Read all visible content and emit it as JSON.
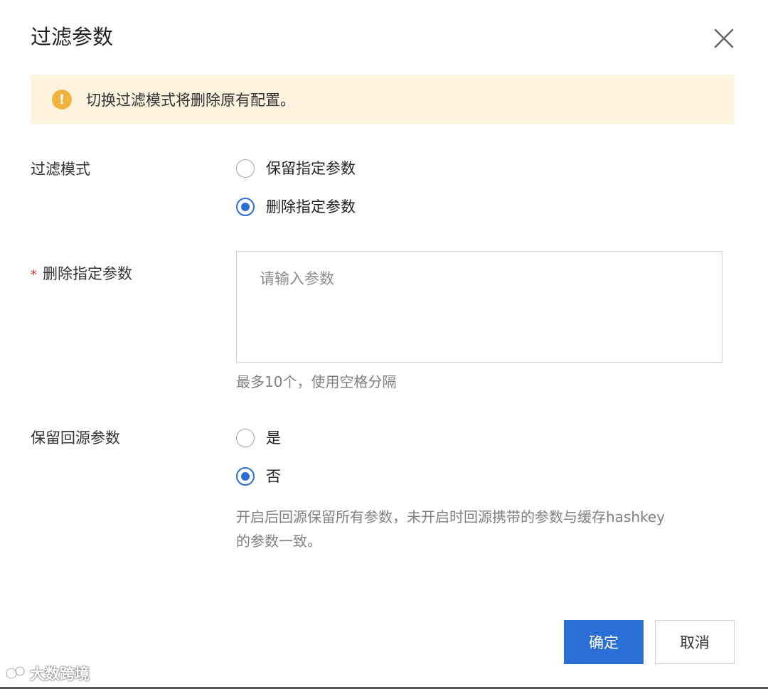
{
  "dialog": {
    "title": "过滤参数",
    "close_icon": "close-icon"
  },
  "alert": {
    "icon": "warning-icon",
    "text": "切换过滤模式将删除原有配置。"
  },
  "filter_mode": {
    "label": "过滤模式",
    "options": [
      {
        "label": "保留指定参数",
        "checked": false
      },
      {
        "label": "删除指定参数",
        "checked": true
      }
    ]
  },
  "delete_params": {
    "required_mark": "*",
    "label": "删除指定参数",
    "placeholder": "请输入参数",
    "value": "",
    "help": "最多10个，使用空格分隔"
  },
  "keep_origin": {
    "label": "保留回源参数",
    "options": [
      {
        "label": "是",
        "checked": false
      },
      {
        "label": "否",
        "checked": true
      }
    ],
    "help_line1": "开启后回源保留所有参数，未开启时回源携带的参数与缓存hashkey",
    "help_line2": "的参数一致。"
  },
  "footer": {
    "confirm_label": "确定",
    "cancel_label": "取消"
  },
  "watermark": {
    "text": "大数跨境"
  },
  "colors": {
    "primary": "#2b6fd6",
    "alert_bg": "#fdf3de",
    "warning": "#f2b33d",
    "required": "#d9362e"
  }
}
